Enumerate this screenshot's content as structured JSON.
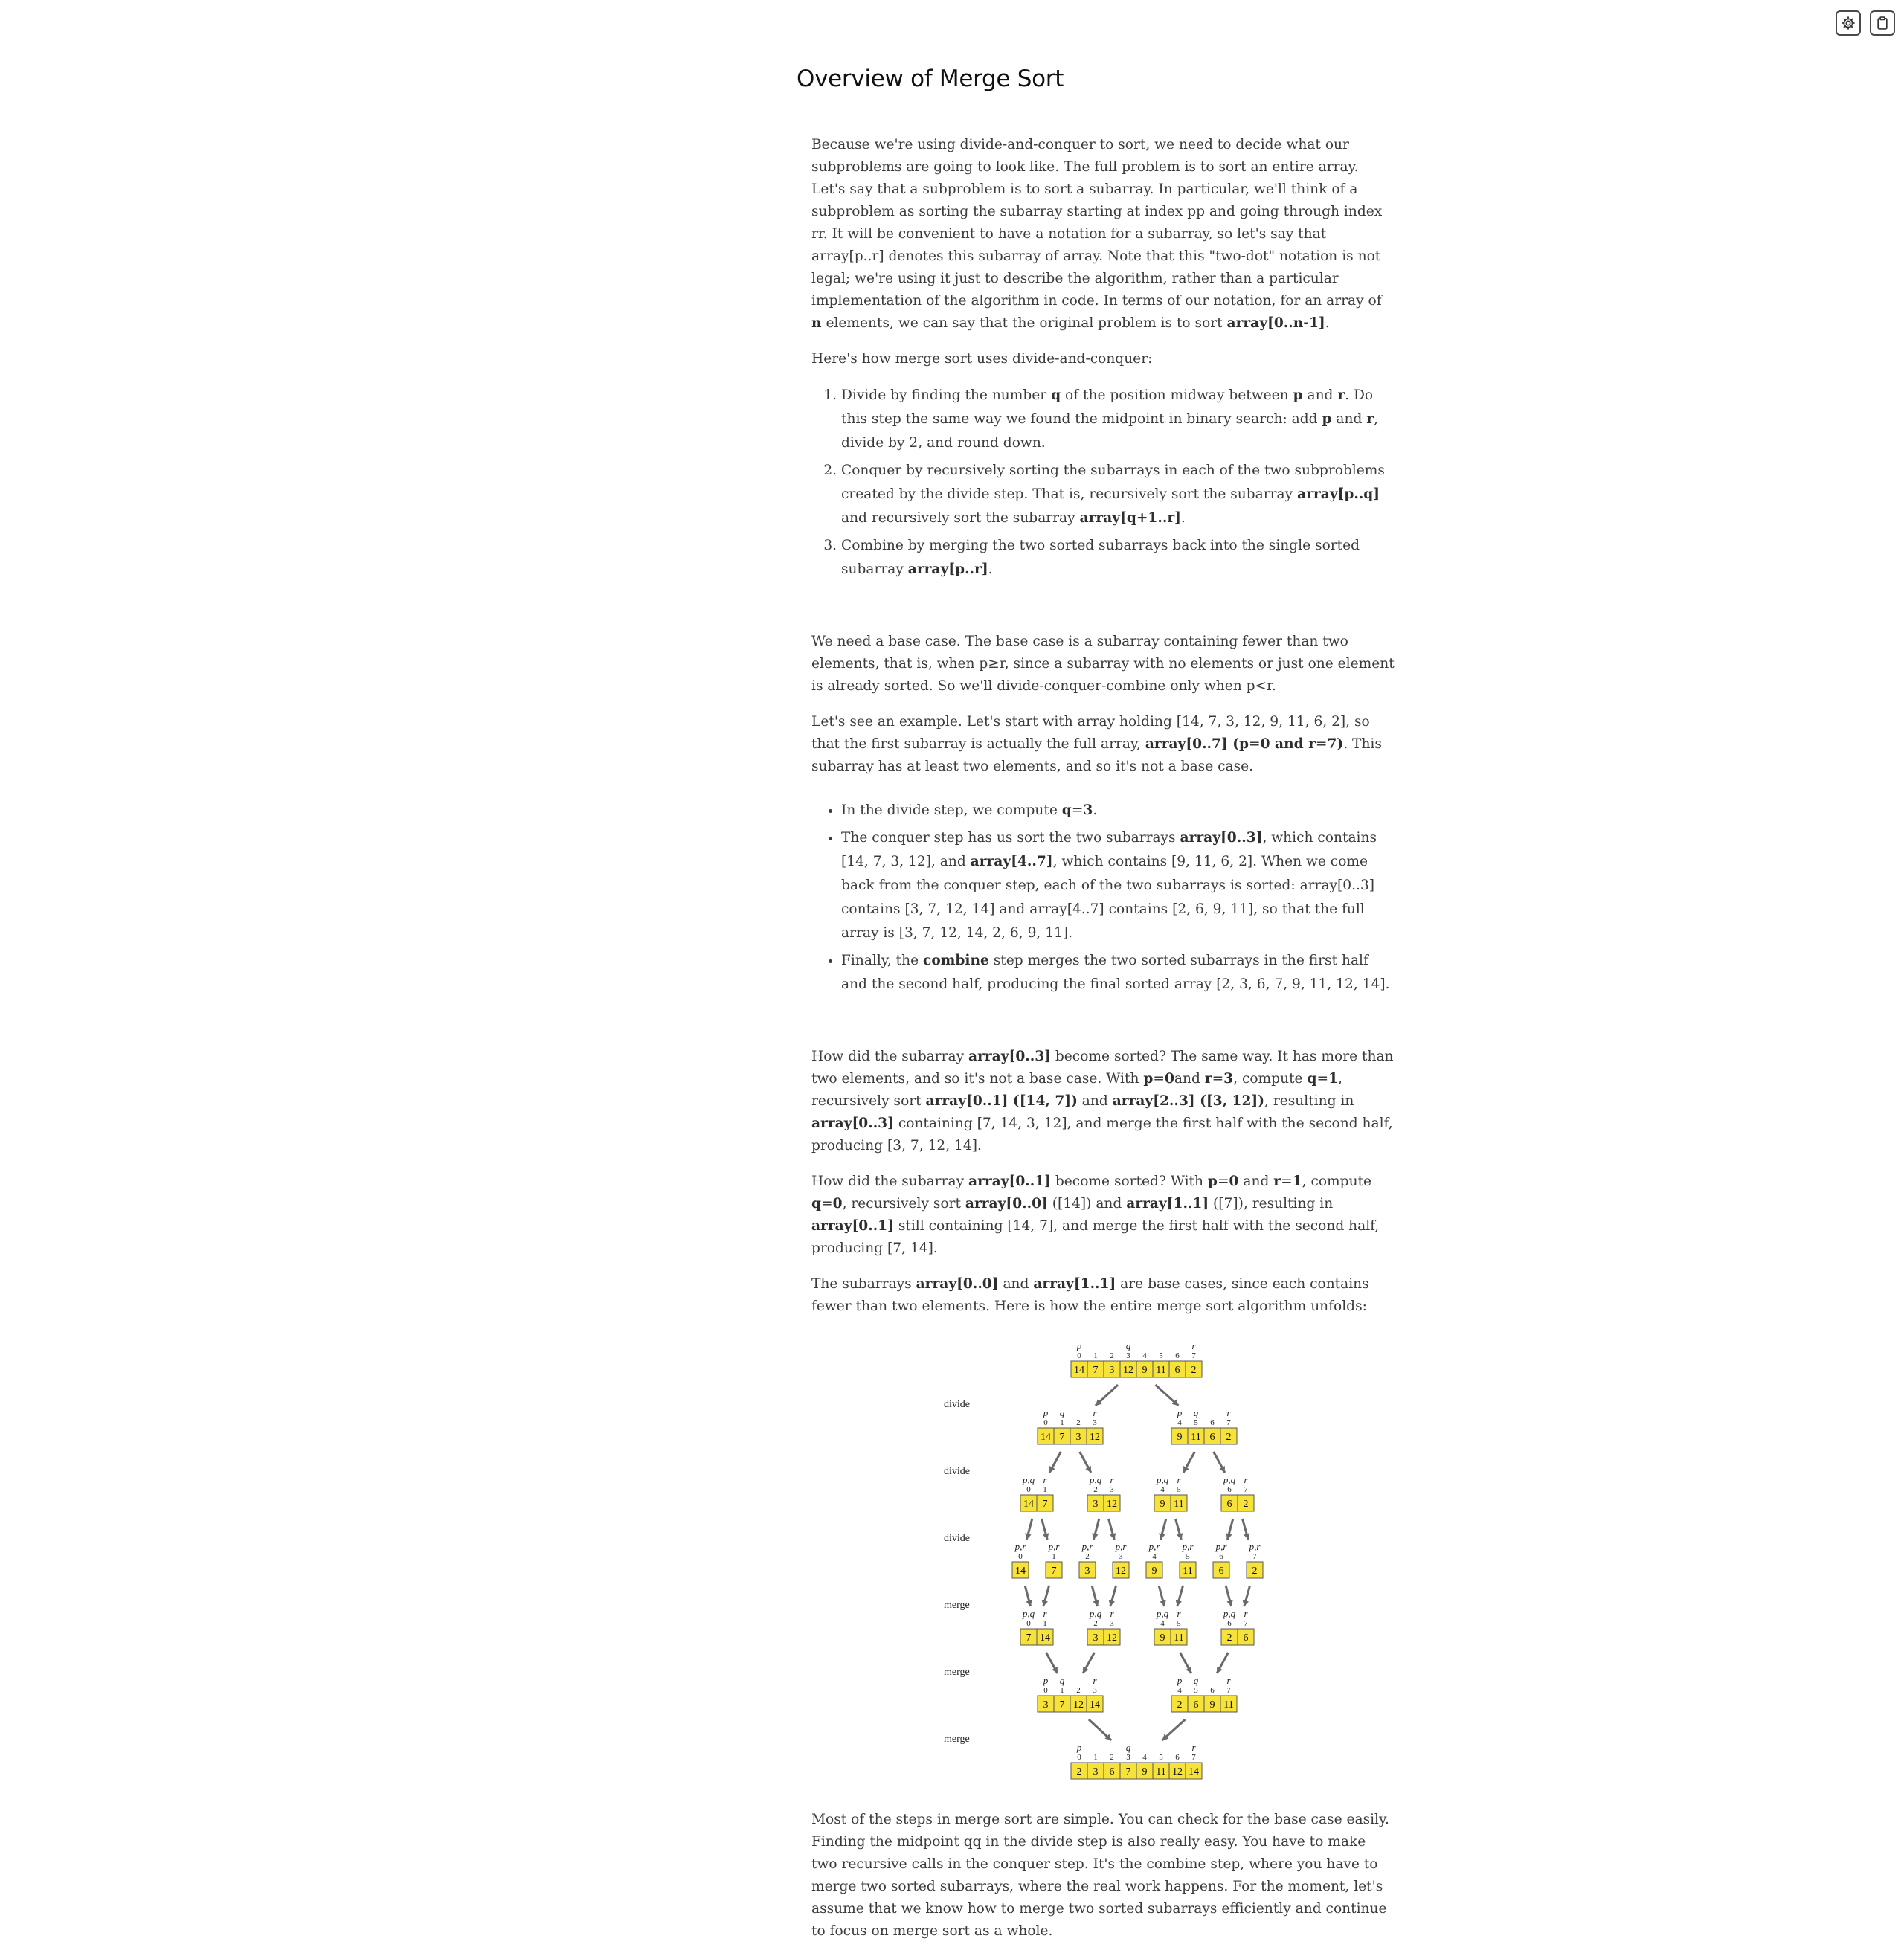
{
  "toolbar": {
    "settings_icon": "gear-icon",
    "clipboard_icon": "clipboard-icon"
  },
  "title": "Overview of Merge Sort",
  "p1": [
    {
      "t": "Because we're using divide-and-conquer to sort, we need to decide what our subproblems are going to look like. The full problem is to sort an entire array. Let's say that a subproblem is to sort a subarray. In particular, we'll think of a subproblem as sorting the subarray starting at index pp and going through index rr. It will be convenient to have a notation for a subarray, so let's say that array[p..r] denotes this subarray of array. Note that this \"two-dot\" notation is not legal; we're using it just to describe the algorithm, rather than a particular implementation of the algorithm in code. In terms of our notation, for an array of "
    },
    {
      "t": "n",
      "b": true
    },
    {
      "t": " elements, we can say that the original problem is to sort "
    },
    {
      "t": "array[0..n-1]",
      "b": true
    },
    {
      "t": "."
    }
  ],
  "p2": [
    {
      "t": "Here's how merge sort uses divide-and-conquer:"
    }
  ],
  "ol": [
    [
      {
        "t": "Divide by finding the number "
      },
      {
        "t": "q",
        "b": true
      },
      {
        "t": " of the position midway between "
      },
      {
        "t": "p",
        "b": true
      },
      {
        "t": " and "
      },
      {
        "t": "r",
        "b": true
      },
      {
        "t": ". Do this step the same way we found the midpoint in binary search: add "
      },
      {
        "t": "p",
        "b": true
      },
      {
        "t": " and "
      },
      {
        "t": "r",
        "b": true
      },
      {
        "t": ", divide by 2, and round down."
      }
    ],
    [
      {
        "t": "Conquer by recursively sorting the subarrays in each of the two subproblems created by the divide step. That is, recursively sort the subarray "
      },
      {
        "t": "array[p..q]",
        "b": true
      },
      {
        "t": " and recursively sort the subarray "
      },
      {
        "t": "array[q+1..r]",
        "b": true
      },
      {
        "t": "."
      }
    ],
    [
      {
        "t": "Combine by merging the two sorted subarrays back into the single sorted subarray "
      },
      {
        "t": "array[p..r]",
        "b": true
      },
      {
        "t": "."
      }
    ]
  ],
  "p3": [
    {
      "t": "We need a base case. The base case is a subarray containing fewer than two elements, that is, when p≥r, since a subarray with no elements or just one element is already sorted. So we'll divide-conquer-combine only when p<r."
    }
  ],
  "p4": [
    {
      "t": "Let's see an example. Let's start with array holding [14, 7, 3, 12, 9, 11, 6, 2], so that the first subarray is actually the full array, "
    },
    {
      "t": "array[0..7] (p",
      "b": true
    },
    {
      "t": "="
    },
    {
      "t": "0 and r",
      "b": true
    },
    {
      "t": "="
    },
    {
      "t": "7)",
      "b": true
    },
    {
      "t": ". This subarray has at least two elements, and so it's not a base case."
    }
  ],
  "ul": [
    [
      {
        "t": "In the divide step, we compute "
      },
      {
        "t": "q",
        "b": true
      },
      {
        "t": "="
      },
      {
        "t": "3",
        "b": true
      },
      {
        "t": "."
      }
    ],
    [
      {
        "t": "The conquer step has us sort the two subarrays "
      },
      {
        "t": "array[0..3]",
        "b": true
      },
      {
        "t": ", which contains [14, 7, 3, 12], and "
      },
      {
        "t": "array[4..7]",
        "b": true
      },
      {
        "t": ", which contains [9, 11, 6, 2]. When we come back from the conquer step, each of the two subarrays is sorted: array[0..3] contains [3, 7, 12, 14] and array[4..7] contains [2, 6, 9, 11], so that the full array is [3, 7, 12, 14, 2, 6, 9, 11]."
      }
    ],
    [
      {
        "t": "Finally, the "
      },
      {
        "t": "combine",
        "b": true
      },
      {
        "t": " step merges the two sorted subarrays in the first half and the second half, producing the final sorted array [2, 3, 6, 7, 9, 11, 12, 14]."
      }
    ]
  ],
  "p5": [
    {
      "t": "How did the subarray "
    },
    {
      "t": "array[0..3]",
      "b": true
    },
    {
      "t": " become sorted? The same way. It has more than two elements, and so it's not a base case. With "
    },
    {
      "t": "p",
      "b": true
    },
    {
      "t": "="
    },
    {
      "t": "0",
      "b": true
    },
    {
      "t": "and "
    },
    {
      "t": "r",
      "b": true
    },
    {
      "t": "="
    },
    {
      "t": "3",
      "b": true
    },
    {
      "t": ", compute "
    },
    {
      "t": "q",
      "b": true
    },
    {
      "t": "="
    },
    {
      "t": "1",
      "b": true
    },
    {
      "t": ", recursively sort "
    },
    {
      "t": "array[0..1] ([14, 7])",
      "b": true
    },
    {
      "t": " and "
    },
    {
      "t": "array[2..3] ([3, 12])",
      "b": true
    },
    {
      "t": ", resulting in "
    },
    {
      "t": "array[0..3]",
      "b": true
    },
    {
      "t": " containing [7, 14, 3, 12], and merge the first half with the second half, producing [3, 7, 12, 14]."
    }
  ],
  "p6": [
    {
      "t": "How did the subarray "
    },
    {
      "t": "array[0..1]",
      "b": true
    },
    {
      "t": " become sorted? With "
    },
    {
      "t": "p",
      "b": true
    },
    {
      "t": "="
    },
    {
      "t": "0",
      "b": true
    },
    {
      "t": " and "
    },
    {
      "t": "r",
      "b": true
    },
    {
      "t": "="
    },
    {
      "t": "1",
      "b": true
    },
    {
      "t": ", compute "
    },
    {
      "t": "q",
      "b": true
    },
    {
      "t": "="
    },
    {
      "t": "0",
      "b": true
    },
    {
      "t": ", recursively sort "
    },
    {
      "t": "array[0..0]",
      "b": true
    },
    {
      "t": " ([14]) and "
    },
    {
      "t": "array[1..1]",
      "b": true
    },
    {
      "t": " ([7]), resulting in "
    },
    {
      "t": "array[0..1]",
      "b": true
    },
    {
      "t": " still containing [14, 7], and merge the first half with the second half, producing [7, 14]."
    }
  ],
  "p7": [
    {
      "t": "The subarrays "
    },
    {
      "t": "array[0..0]",
      "b": true
    },
    {
      "t": " and "
    },
    {
      "t": "array[1..1]",
      "b": true
    },
    {
      "t": " are base cases, since each contains fewer than two elements. Here is how the entire merge sort algorithm unfolds:"
    }
  ],
  "p8": [
    {
      "t": "Most of the steps in merge sort are simple. You can check for the base case easily. Finding the midpoint qq in the divide step is also really easy. You have to make two recursive calls in the conquer step. It's the combine step, where you have to merge two sorted subarrays, where the real work happens. For the moment, let's assume that we know how to merge two sorted subarrays efficiently and continue to focus on merge sort as a whole."
    }
  ],
  "diagram": {
    "step_labels": [
      "divide",
      "divide",
      "divide",
      "merge",
      "merge",
      "merge"
    ],
    "levels": [
      [
        {
          "start": 0,
          "values": [
            14,
            7,
            3,
            12,
            9,
            11,
            6,
            2
          ],
          "labels": {
            "0": "p",
            "3": "q",
            "7": "r"
          }
        }
      ],
      [
        {
          "start": 0,
          "values": [
            14,
            7,
            3,
            12
          ],
          "labels": {
            "0": "p",
            "1": "q",
            "3": "r"
          }
        },
        {
          "start": 4,
          "values": [
            9,
            11,
            6,
            2
          ],
          "labels": {
            "0": "p",
            "1": "q",
            "3": "r"
          }
        }
      ],
      [
        {
          "start": 0,
          "values": [
            14,
            7
          ],
          "labels": {
            "0": "p,q",
            "1": "r"
          }
        },
        {
          "start": 2,
          "values": [
            3,
            12
          ],
          "labels": {
            "0": "p,q",
            "1": "r"
          }
        },
        {
          "start": 4,
          "values": [
            9,
            11
          ],
          "labels": {
            "0": "p,q",
            "1": "r"
          }
        },
        {
          "start": 6,
          "values": [
            6,
            2
          ],
          "labels": {
            "0": "p,q",
            "1": "r"
          }
        }
      ],
      [
        {
          "start": 0,
          "values": [
            14
          ],
          "labels": {
            "0": "p,r"
          }
        },
        {
          "start": 1,
          "values": [
            7
          ],
          "labels": {
            "0": "p,r"
          }
        },
        {
          "start": 2,
          "values": [
            3
          ],
          "labels": {
            "0": "p,r"
          }
        },
        {
          "start": 3,
          "values": [
            12
          ],
          "labels": {
            "0": "p,r"
          }
        },
        {
          "start": 4,
          "values": [
            9
          ],
          "labels": {
            "0": "p,r"
          }
        },
        {
          "start": 5,
          "values": [
            11
          ],
          "labels": {
            "0": "p,r"
          }
        },
        {
          "start": 6,
          "values": [
            6
          ],
          "labels": {
            "0": "p,r"
          }
        },
        {
          "start": 7,
          "values": [
            2
          ],
          "labels": {
            "0": "p,r"
          }
        }
      ],
      [
        {
          "start": 0,
          "values": [
            7,
            14
          ],
          "labels": {
            "0": "p,q",
            "1": "r"
          }
        },
        {
          "start": 2,
          "values": [
            3,
            12
          ],
          "labels": {
            "0": "p,q",
            "1": "r"
          }
        },
        {
          "start": 4,
          "values": [
            9,
            11
          ],
          "labels": {
            "0": "p,q",
            "1": "r"
          }
        },
        {
          "start": 6,
          "values": [
            2,
            6
          ],
          "labels": {
            "0": "p,q",
            "1": "r"
          }
        }
      ],
      [
        {
          "start": 0,
          "values": [
            3,
            7,
            12,
            14
          ],
          "labels": {
            "0": "p",
            "1": "q",
            "3": "r"
          }
        },
        {
          "start": 4,
          "values": [
            2,
            6,
            9,
            11
          ],
          "labels": {
            "0": "p",
            "1": "q",
            "3": "r"
          }
        }
      ],
      [
        {
          "start": 0,
          "values": [
            2,
            3,
            6,
            7,
            9,
            11,
            12,
            14
          ],
          "labels": {
            "0": "p",
            "3": "q",
            "7": "r"
          }
        }
      ]
    ]
  }
}
